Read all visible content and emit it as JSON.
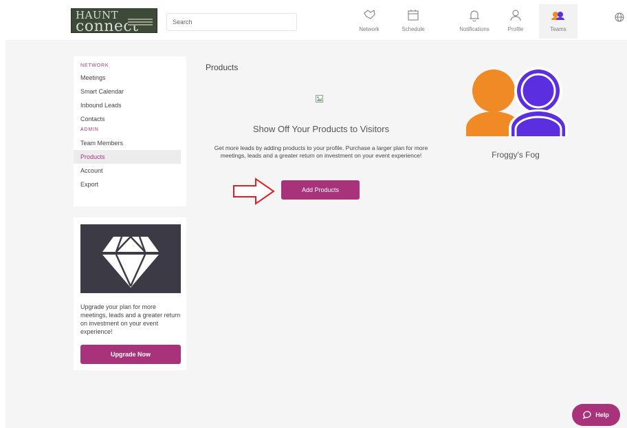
{
  "header": {
    "logo_text_top": "HAUNT",
    "logo_text_bottom": "connect",
    "search_placeholder": "Search",
    "nav": [
      {
        "label": "Network",
        "icon": "handshake-icon"
      },
      {
        "label": "Schedule",
        "icon": "calendar-icon"
      },
      {
        "label": "Notifications",
        "icon": "bell-icon"
      },
      {
        "label": "Profile",
        "icon": "person-icon"
      },
      {
        "label": "Teams",
        "icon": "team-icon"
      }
    ],
    "active_nav": "Teams"
  },
  "sidebar": {
    "network_heading": "NETWORK",
    "network_items": [
      "Meetings",
      "Smart Calendar",
      "Inbound Leads",
      "Contacts"
    ],
    "admin_heading": "ADMIN",
    "admin_items": [
      "Team Members",
      "Products",
      "Account",
      "Export"
    ],
    "active_item": "Products"
  },
  "promo": {
    "text": "Upgrade your plan for more meetings, leads and a greater return on investment on your event experience!",
    "button": "Upgrade Now"
  },
  "main": {
    "title": "Products",
    "heading": "Show Off Your Products to Visitors",
    "body": "Get more leads by adding products to your profile. Purchase a larger plan for more meetings, leads and a greater return on investment on your event experience!",
    "button": "Add Products"
  },
  "team": {
    "name": "Froggy's Fog"
  },
  "help": {
    "label": "Help"
  },
  "colors": {
    "accent": "#a8337a",
    "orange": "#f08a24",
    "purple": "#5b2ee0",
    "arrow": "#e02020"
  }
}
